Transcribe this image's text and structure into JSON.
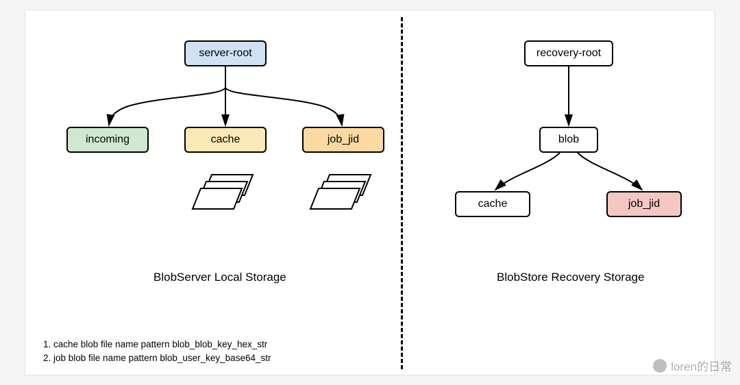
{
  "left": {
    "root": "server-root",
    "children": [
      "incoming",
      "cache",
      "job_jid"
    ],
    "caption": "BlobServer Local Storage"
  },
  "right": {
    "root": "recovery-root",
    "mid": "blob",
    "children": [
      "cache",
      "job_jid"
    ],
    "caption": "BlobStore Recovery Storage"
  },
  "notes": {
    "line1": "1. cache blob file name pattern blob_blob_key_hex_str",
    "line2": "2. job blob file name pattern blob_user_key_base64_str"
  },
  "watermark": "loren的日常"
}
